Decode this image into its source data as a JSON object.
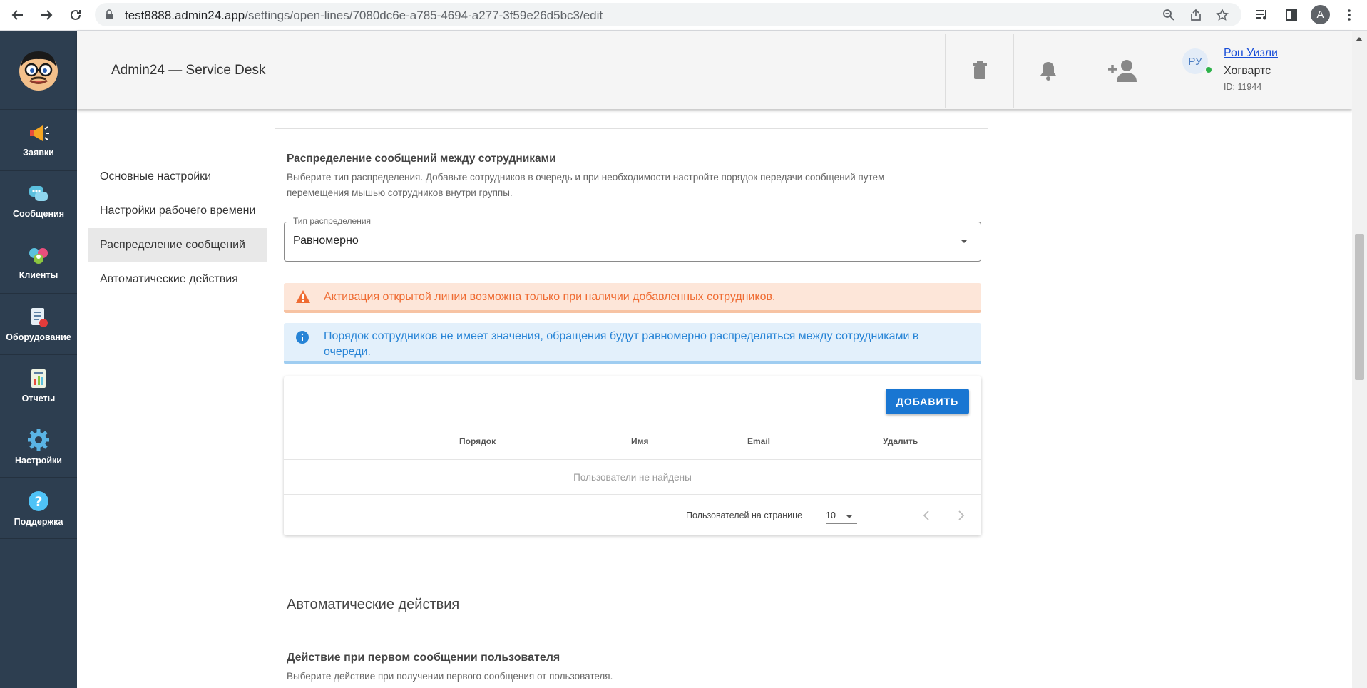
{
  "browser": {
    "url_host": "test8888.admin24.app",
    "url_path": "/settings/open-lines/7080dc6e-a785-4694-a277-3f59e26d5bc3/edit",
    "profile_initial": "A"
  },
  "sidebar": {
    "items": [
      {
        "label": "Заявки",
        "icon": "megaphone-icon"
      },
      {
        "label": "Сообщения",
        "icon": "chat-bubbles-icon"
      },
      {
        "label": "Клиенты",
        "icon": "clients-icon"
      },
      {
        "label": "Оборудование",
        "icon": "equipment-icon"
      },
      {
        "label": "Отчеты",
        "icon": "report-icon"
      },
      {
        "label": "Настройки",
        "icon": "gear-icon"
      },
      {
        "label": "Поддержка",
        "icon": "help-icon"
      }
    ]
  },
  "header": {
    "title": "Admin24 — Service Desk",
    "user": {
      "initials": "РУ",
      "name": "Рон Уизли",
      "org": "Хогвартс",
      "id_text": "ID: 11944"
    }
  },
  "settings_nav": {
    "items": [
      {
        "label": "Основные настройки",
        "active": false
      },
      {
        "label": "Настройки рабочего времени",
        "active": false
      },
      {
        "label": "Распределение сообщений",
        "active": true
      },
      {
        "label": "Автоматические действия",
        "active": false
      }
    ]
  },
  "distribution": {
    "title": "Распределение сообщений между сотрудниками",
    "description": "Выберите тип распределения. Добавьте сотрудников в очередь и при необходимости настройте порядок передачи сообщений путем перемещения мышью сотрудников внутри группы.",
    "select_label": "Тип распределения",
    "select_value": "Равномерно",
    "warning": "Активация открытой линии возможна только при наличии добавленных сотрудников.",
    "info": "Порядок сотрудников не имеет значения, обращения будут равномерно распределяться между сотрудниками в очереди.",
    "add_button": "ДОБАВИТЬ",
    "columns": [
      "Порядок",
      "Имя",
      "Email",
      "Удалить"
    ],
    "empty_text": "Пользователи не найдены",
    "per_page_label": "Пользователей на странице",
    "per_page_value": "10",
    "range_text": "–"
  },
  "auto_actions": {
    "title": "Автоматические действия",
    "first_message_title": "Действие при первом сообщении пользователя",
    "first_message_desc": "Выберите действие при получении первого сообщения от пользователя."
  },
  "colors": {
    "sidebar_bg": "#2d3e50",
    "accent": "#1976d2",
    "warning": "#ef6c33",
    "info": "#2784d6"
  }
}
